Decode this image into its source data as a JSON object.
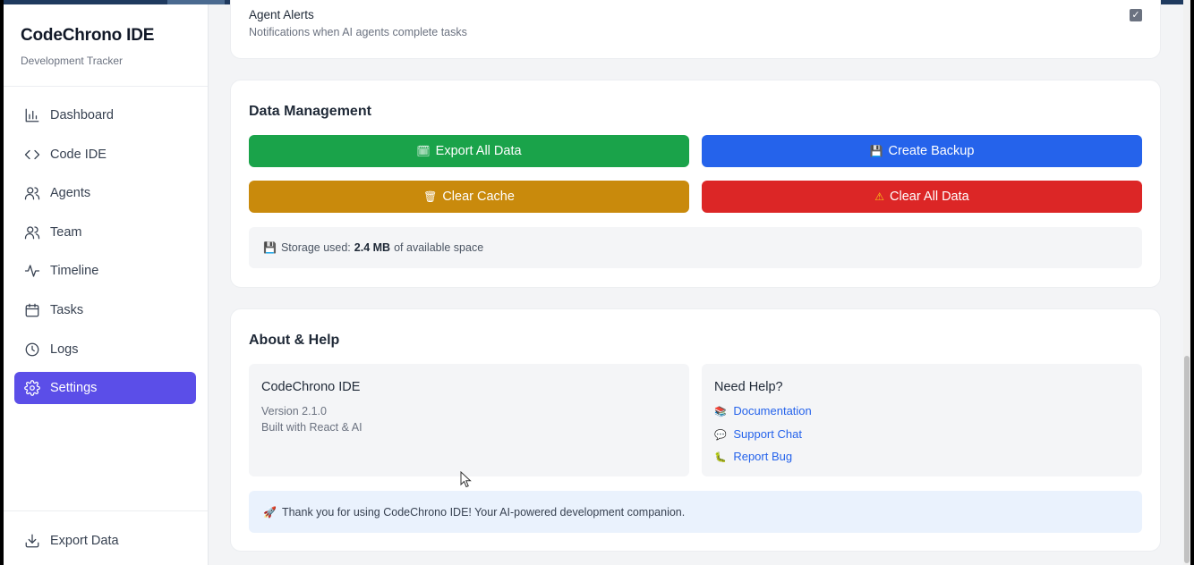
{
  "app": {
    "title": "CodeChrono IDE",
    "subtitle": "Development Tracker"
  },
  "sidebar": {
    "items": [
      {
        "label": "Dashboard",
        "icon": "bar-chart-icon"
      },
      {
        "label": "Code IDE",
        "icon": "code-icon"
      },
      {
        "label": "Agents",
        "icon": "users-icon"
      },
      {
        "label": "Team",
        "icon": "users-icon"
      },
      {
        "label": "Timeline",
        "icon": "activity-icon"
      },
      {
        "label": "Tasks",
        "icon": "calendar-icon"
      },
      {
        "label": "Logs",
        "icon": "clock-icon"
      },
      {
        "label": "Settings",
        "icon": "gear-icon",
        "active": true
      }
    ],
    "footer": {
      "label": "Export Data",
      "icon": "download-icon"
    }
  },
  "alerts": {
    "title": "Agent Alerts",
    "description": "Notifications when AI agents complete tasks",
    "checked": true,
    "check_glyph": "✓"
  },
  "data_management": {
    "heading": "Data Management",
    "export_all": {
      "emoji": "🗓",
      "label": "Export All Data"
    },
    "create_backup": {
      "emoji": "💾",
      "label": "Create Backup"
    },
    "clear_cache": {
      "emoji": "🗑",
      "label": "Clear Cache"
    },
    "clear_all": {
      "emoji": "⚠",
      "label": "Clear All Data"
    },
    "storage": {
      "emoji": "💾",
      "prefix": "Storage used:",
      "amount": "2.4 MB",
      "suffix": "of available space"
    }
  },
  "about": {
    "heading": "About & Help",
    "product": {
      "title": "CodeChrono IDE",
      "version": "Version 2.1.0",
      "built_with": "Built with React & AI"
    },
    "help": {
      "title": "Need Help?",
      "links": [
        {
          "emoji": "📚",
          "label": "Documentation"
        },
        {
          "emoji": "💬",
          "label": "Support Chat"
        },
        {
          "emoji": "🐛",
          "label": "Report Bug"
        }
      ]
    },
    "thanks": {
      "emoji": "🚀",
      "text": "Thank you for using CodeChrono IDE! Your AI-powered development companion."
    }
  },
  "colors": {
    "accent": "#5b4ee8",
    "export": "#1aa34a",
    "backup": "#2563eb",
    "cache": "#c98a0c",
    "danger": "#dc2626",
    "link": "#2563eb"
  }
}
